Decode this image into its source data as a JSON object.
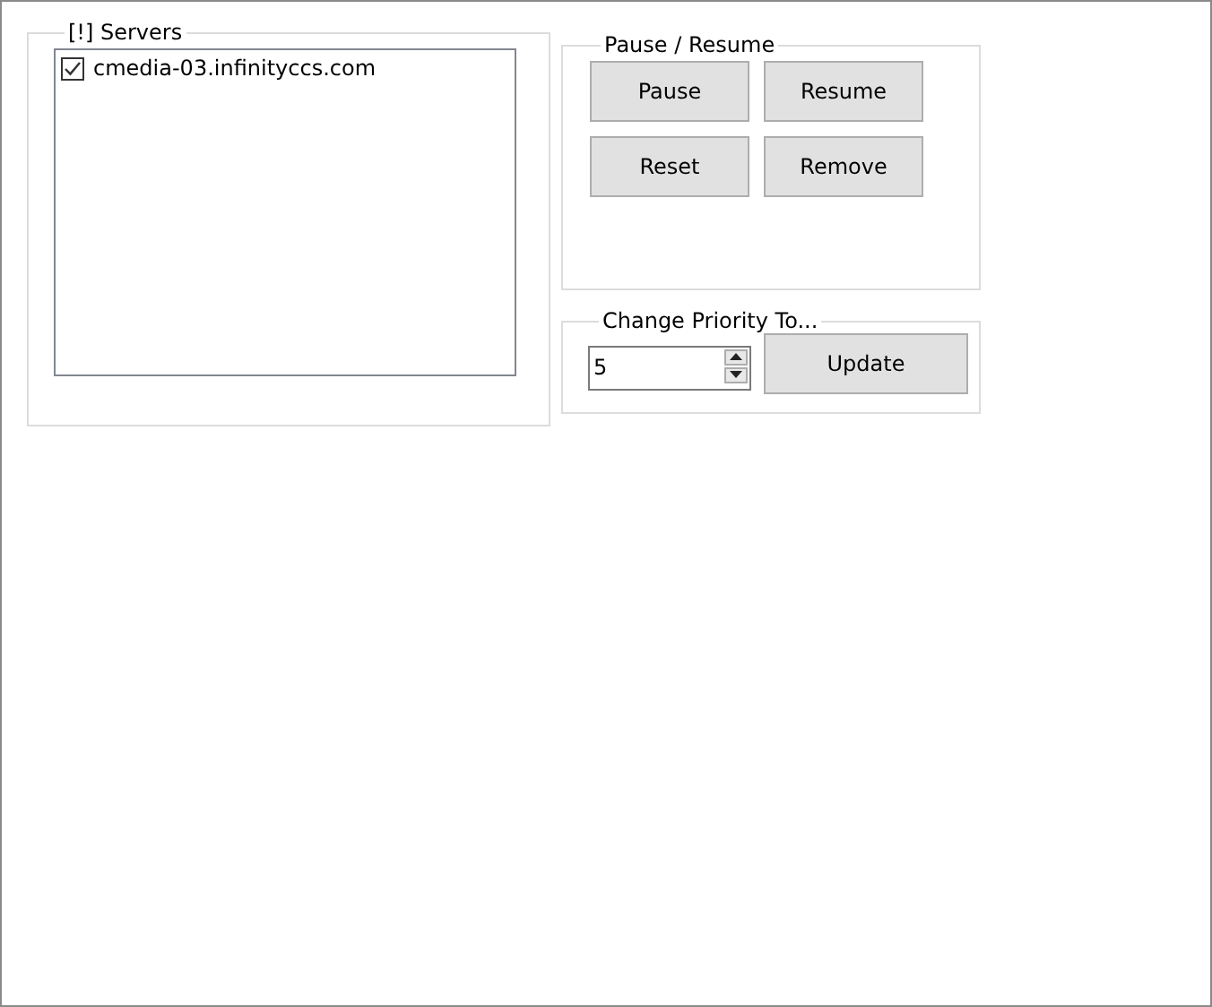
{
  "servers": {
    "title": "[!] Servers",
    "items": [
      {
        "label": "cmedia-03.infinityccs.com",
        "checked": true
      }
    ]
  },
  "pause_resume": {
    "title": "Pause / Resume",
    "buttons": [
      "Pause",
      "Resume",
      "Reset",
      "Remove"
    ]
  },
  "change_priority": {
    "title": "Change Priority To...",
    "value": "5",
    "button": "Update"
  }
}
